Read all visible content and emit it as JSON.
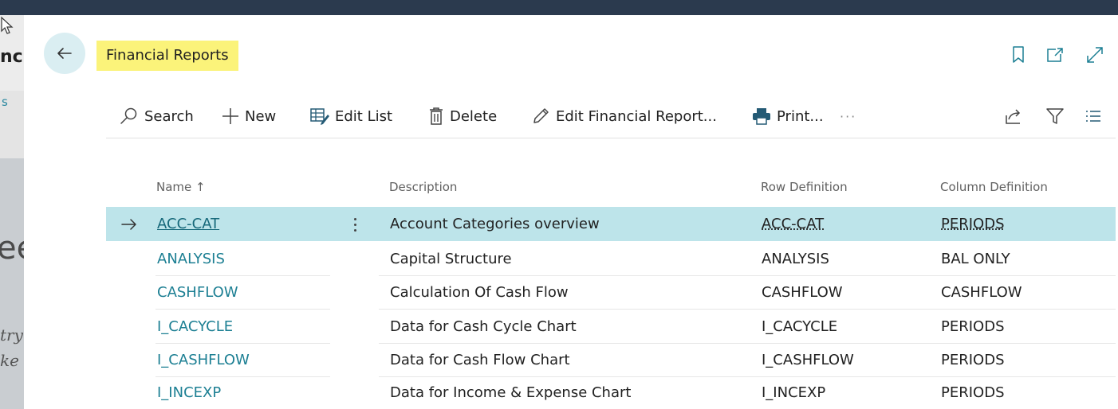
{
  "background": {
    "fragments": [
      "nc.",
      "s",
      "ee",
      "try",
      "ke"
    ]
  },
  "header": {
    "title": "Financial Reports"
  },
  "toolbar": {
    "search_label": "Search",
    "new_label": "New",
    "edit_list_label": "Edit List",
    "delete_label": "Delete",
    "edit_financial_report_label": "Edit Financial Report...",
    "print_label": "Print...",
    "more_label": "···"
  },
  "table": {
    "columns": {
      "name": "Name ↑",
      "description": "Description",
      "row_definition": "Row Definition",
      "column_definition": "Column Definition"
    },
    "rows": [
      {
        "name": "ACC-CAT",
        "description": "Account Categories overview",
        "row_definition": "ACC-CAT",
        "column_definition": "PERIODS"
      },
      {
        "name": "ANALYSIS",
        "description": "Capital Structure",
        "row_definition": "ANALYSIS",
        "column_definition": "BAL ONLY"
      },
      {
        "name": "CASHFLOW",
        "description": "Calculation Of Cash Flow",
        "row_definition": "CASHFLOW",
        "column_definition": "CASHFLOW"
      },
      {
        "name": "I_CACYCLE",
        "description": "Data for Cash Cycle Chart",
        "row_definition": "I_CACYCLE",
        "column_definition": "PERIODS"
      },
      {
        "name": "I_CASHFLOW",
        "description": "Data for Cash Flow Chart",
        "row_definition": "I_CASHFLOW",
        "column_definition": "PERIODS"
      },
      {
        "name": "I_INCEXP",
        "description": "Data for Income & Expense Chart",
        "row_definition": "I_INCEXP",
        "column_definition": "PERIODS"
      }
    ]
  },
  "colors": {
    "topbar": "#2b3a4e",
    "title_highlight": "#fbf37a",
    "selected_row": "#bde4ea",
    "link": "#1c7f93",
    "accent": "#2b88a0"
  },
  "icons": {
    "back": "arrow-left-icon",
    "bookmark": "bookmark-icon",
    "open_new_window": "open-in-new-window-icon",
    "expand": "expand-icon",
    "search": "search-icon",
    "new": "plus-icon",
    "edit_list": "edit-list-icon",
    "delete": "trash-icon",
    "edit_report": "pencil-icon",
    "print": "printer-icon",
    "share": "share-icon",
    "filter": "filter-icon",
    "list_view": "list-view-icon",
    "row_arrow": "row-arrow-icon",
    "row_menu": "vertical-ellipsis-icon"
  }
}
